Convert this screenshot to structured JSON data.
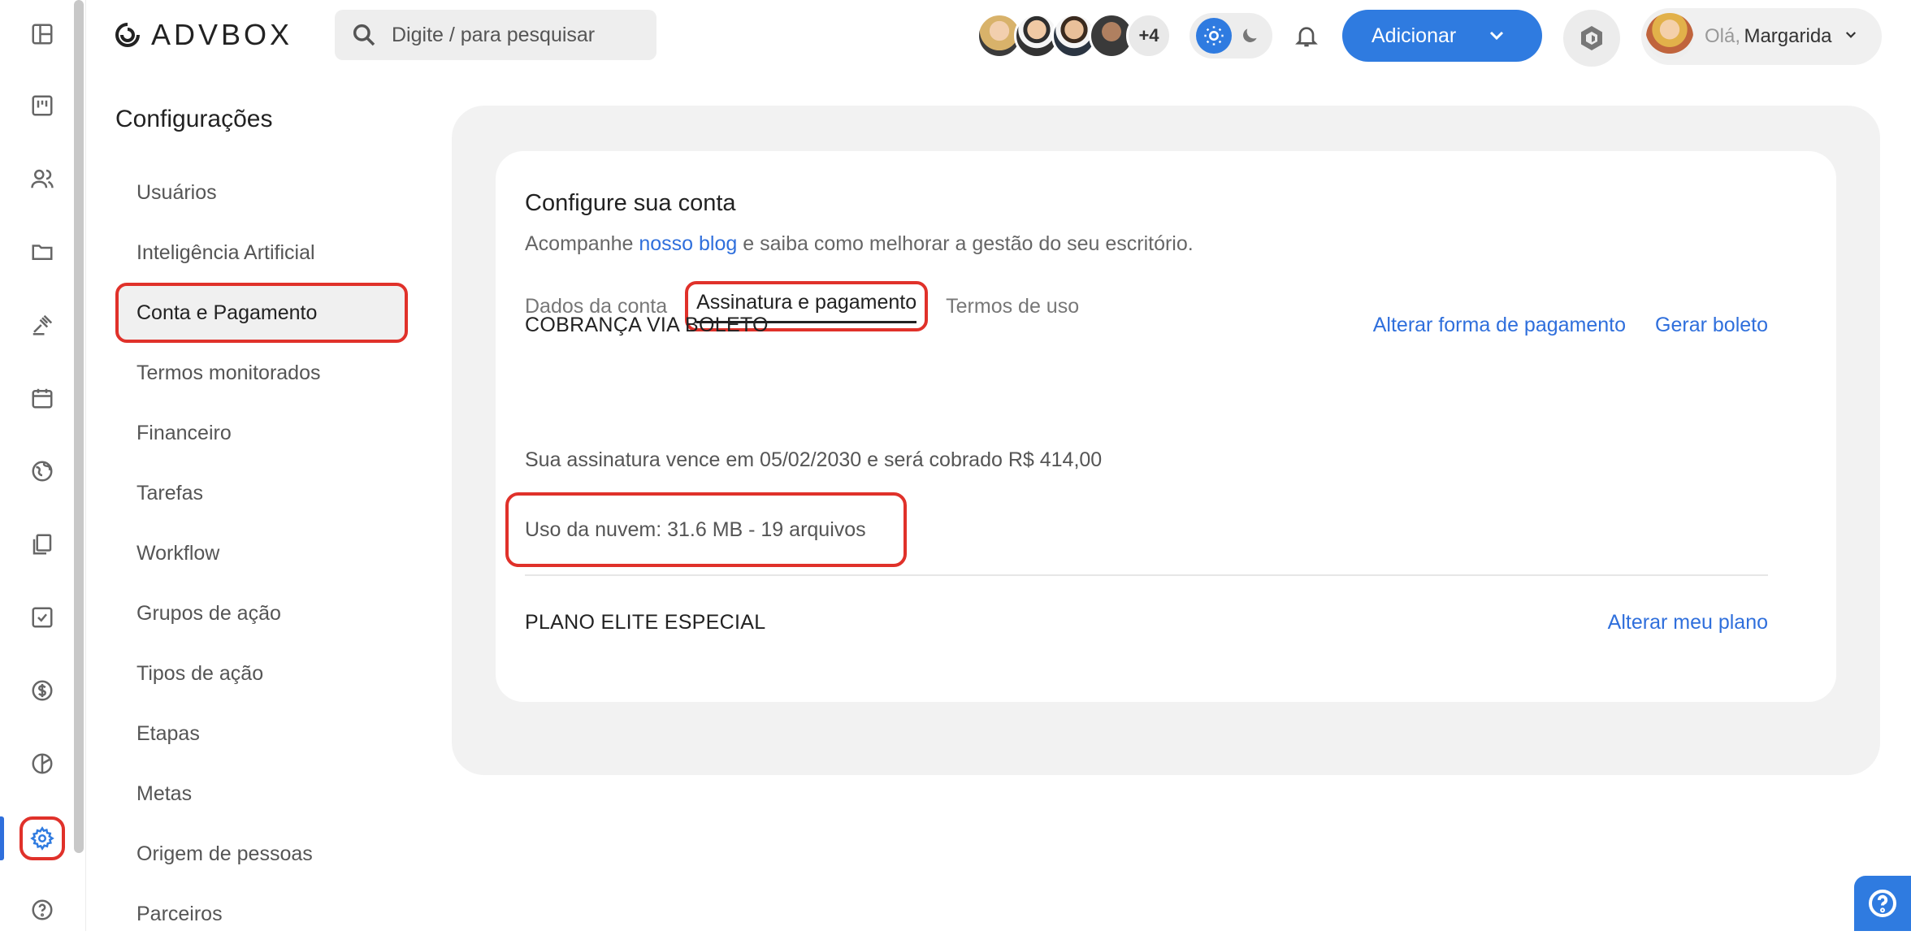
{
  "header": {
    "logo_text": "ADVBOX",
    "search_placeholder": "Digite / para pesquisar",
    "more_avatars": "+4",
    "add_label": "Adicionar",
    "greeting": "Olá,",
    "user_name": "Margarida"
  },
  "rail": {
    "icons": [
      "dashboard-icon",
      "kanban-icon",
      "people-icon",
      "folder-icon",
      "gavel-icon",
      "calendar-icon",
      "globe-icon",
      "documents-icon",
      "tasks-icon",
      "finance-icon",
      "reports-icon",
      "settings-icon",
      "help-icon"
    ],
    "active": "settings-icon"
  },
  "settings": {
    "title": "Configurações",
    "items": [
      {
        "label": "Usuários"
      },
      {
        "label": "Inteligência Artificial"
      },
      {
        "label": "Conta e Pagamento"
      },
      {
        "label": "Termos monitorados"
      },
      {
        "label": "Financeiro"
      },
      {
        "label": "Tarefas"
      },
      {
        "label": "Workflow"
      },
      {
        "label": "Grupos de ação"
      },
      {
        "label": "Tipos de ação"
      },
      {
        "label": "Etapas"
      },
      {
        "label": "Metas"
      },
      {
        "label": "Origem de pessoas"
      },
      {
        "label": "Parceiros"
      }
    ],
    "active": "Conta e Pagamento"
  },
  "account": {
    "title": "Configure sua conta",
    "subtitle_before": "Acompanhe ",
    "subtitle_link": "nosso blog",
    "subtitle_after": " e saiba como melhorar a gestão do seu escritório.",
    "tabs": [
      "Dados da conta",
      "Assinatura e pagamento",
      "Termos de uso"
    ],
    "active_tab": "Assinatura e pagamento",
    "billing_title": "COBRANÇA VIA BOLETO",
    "change_payment": "Alterar forma de pagamento",
    "generate_boleto": "Gerar boleto",
    "subscription_text": "Sua assinatura vence em 05/02/2030 e será cobrado R$ 414,00",
    "cloud_usage": "Uso da nuvem: 31.6 MB - 19 arquivos",
    "plan_title": "PLANO ELITE ESPECIAL",
    "change_plan": "Alterar meu plano"
  },
  "colors": {
    "accent": "#2f7be0",
    "highlight": "#e0312a"
  }
}
